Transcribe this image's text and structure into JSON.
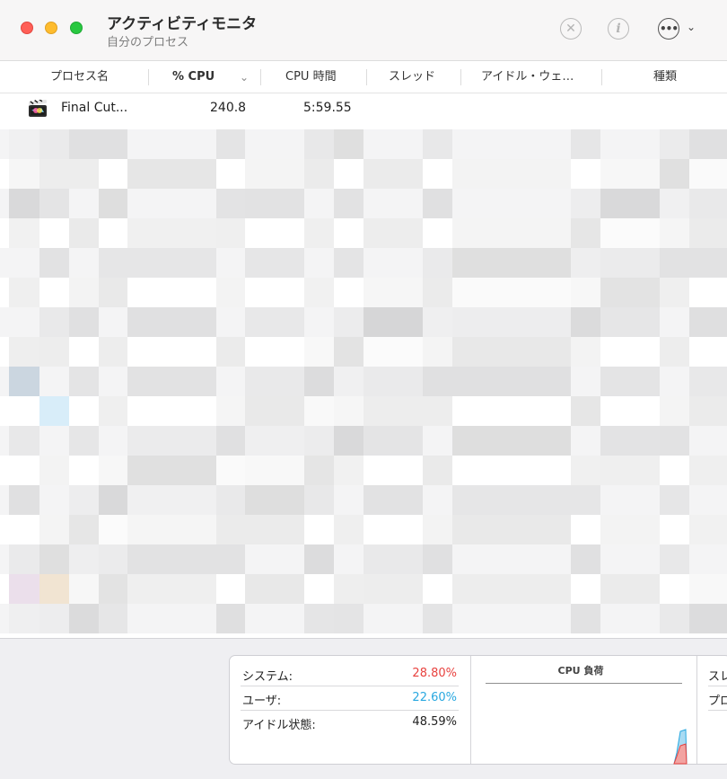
{
  "window": {
    "title": "アクティビティモニタ",
    "subtitle": "自分のプロセス"
  },
  "toolbar": {
    "stop_icon": "x-circle-icon",
    "info_icon": "info-circle-icon",
    "more_icon": "ellipsis-circle-icon",
    "stop_glyph": "✕",
    "info_glyph": "i",
    "more_glyph": "•••",
    "chevron_glyph": "⌄"
  },
  "columns": {
    "process_name": "プロセス名",
    "cpu_percent": "% CPU",
    "cpu_time": "CPU 時間",
    "threads": "スレッド",
    "idle_wake": "アイドル・ウェ…",
    "kind": "種類",
    "sort_indicator": "⌄"
  },
  "process": {
    "name": "Final Cut...",
    "cpu": "240.8",
    "cpu_time": "5:59.55",
    "icon": "final-cut-pro-icon"
  },
  "summary": {
    "system_label": "システム:",
    "system_value": "28.80%",
    "user_label": "ユーザ:",
    "user_value": "22.60%",
    "idle_label": "アイドル状態:",
    "idle_value": "48.59%",
    "cpu_load_title": "CPU 負荷",
    "threads_label_clipped": "スレ",
    "processes_label_clipped": "プロ"
  },
  "colors": {
    "system": "#e8423f",
    "user": "#29a8e0"
  }
}
